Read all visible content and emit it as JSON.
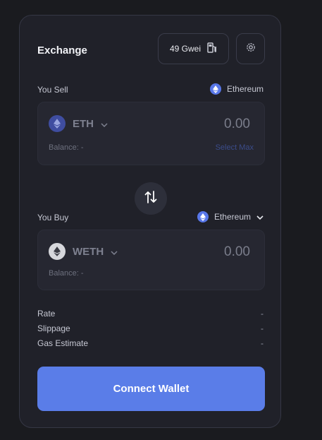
{
  "header": {
    "title": "Exchange",
    "gas_label": "49 Gwei"
  },
  "sell": {
    "label": "You Sell",
    "network": "Ethereum",
    "token": "ETH",
    "amount": "0.00",
    "balance": "Balance: -",
    "select_max": "Select Max"
  },
  "buy": {
    "label": "You Buy",
    "network": "Ethereum",
    "token": "WETH",
    "amount": "0.00",
    "balance": "Balance: -"
  },
  "details": [
    {
      "label": "Rate",
      "value": "-"
    },
    {
      "label": "Slippage",
      "value": "-"
    },
    {
      "label": "Gas Estimate",
      "value": "-"
    }
  ],
  "connect_label": "Connect Wallet",
  "colors": {
    "accent": "#5a7de8",
    "background": "#1a1b1f",
    "card": "#202129"
  },
  "icons": [
    "gas-pump-icon",
    "gear-icon",
    "ethereum-icon",
    "chevron-down-icon",
    "swap-arrows-icon"
  ]
}
